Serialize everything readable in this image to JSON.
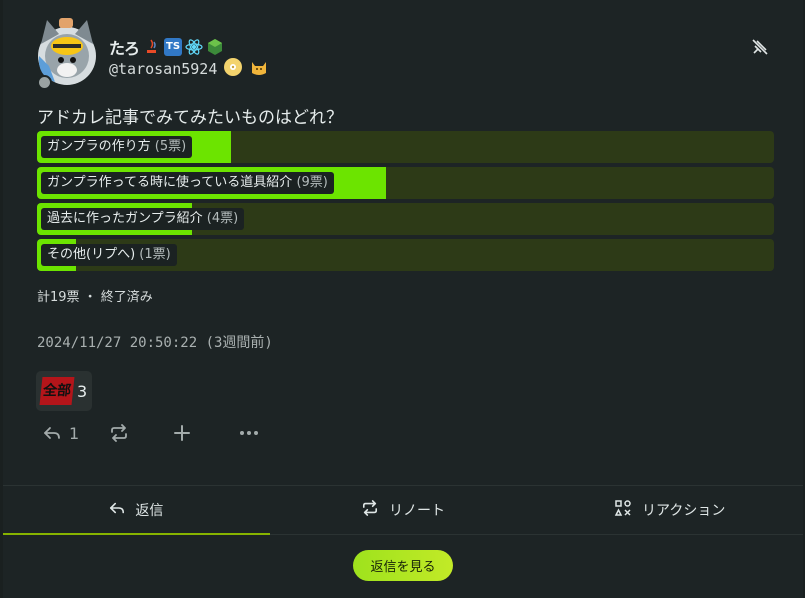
{
  "user": {
    "display_name": "たろ",
    "handle": "@tarosan5924"
  },
  "note": {
    "text": "アドカレ記事でみてみたいものはどれ？",
    "timestamp": "2024/11/27 20:50:22 (3週間前)"
  },
  "poll": {
    "options": [
      {
        "label": "ガンプラの作り方",
        "votes": "(5票)",
        "count": 5
      },
      {
        "label": "ガンプラ作ってる時に使っている道具紹介",
        "votes": "(9票)",
        "count": 9
      },
      {
        "label": "過去に作ったガンプラ紹介",
        "votes": "(4票)",
        "count": 4
      },
      {
        "label": "その他(リプへ)",
        "votes": "(1票)",
        "count": 1
      }
    ],
    "total": 19,
    "summary": "計19票 ・ 終了済み"
  },
  "reaction": {
    "emoji_text": "全部",
    "count": "3"
  },
  "actions": {
    "reply_count": "1"
  },
  "tabs": [
    {
      "label": "返信",
      "icon": "reply-icon"
    },
    {
      "label": "リノート",
      "icon": "renote-icon"
    },
    {
      "label": "リアクション",
      "icon": "reaction-icon"
    }
  ],
  "view_replies_label": "返信を見る",
  "colors": {
    "accent": "#6ce400",
    "poll_track": "#2d3a17",
    "button": "#b0e51f",
    "background": "#1d2425"
  }
}
